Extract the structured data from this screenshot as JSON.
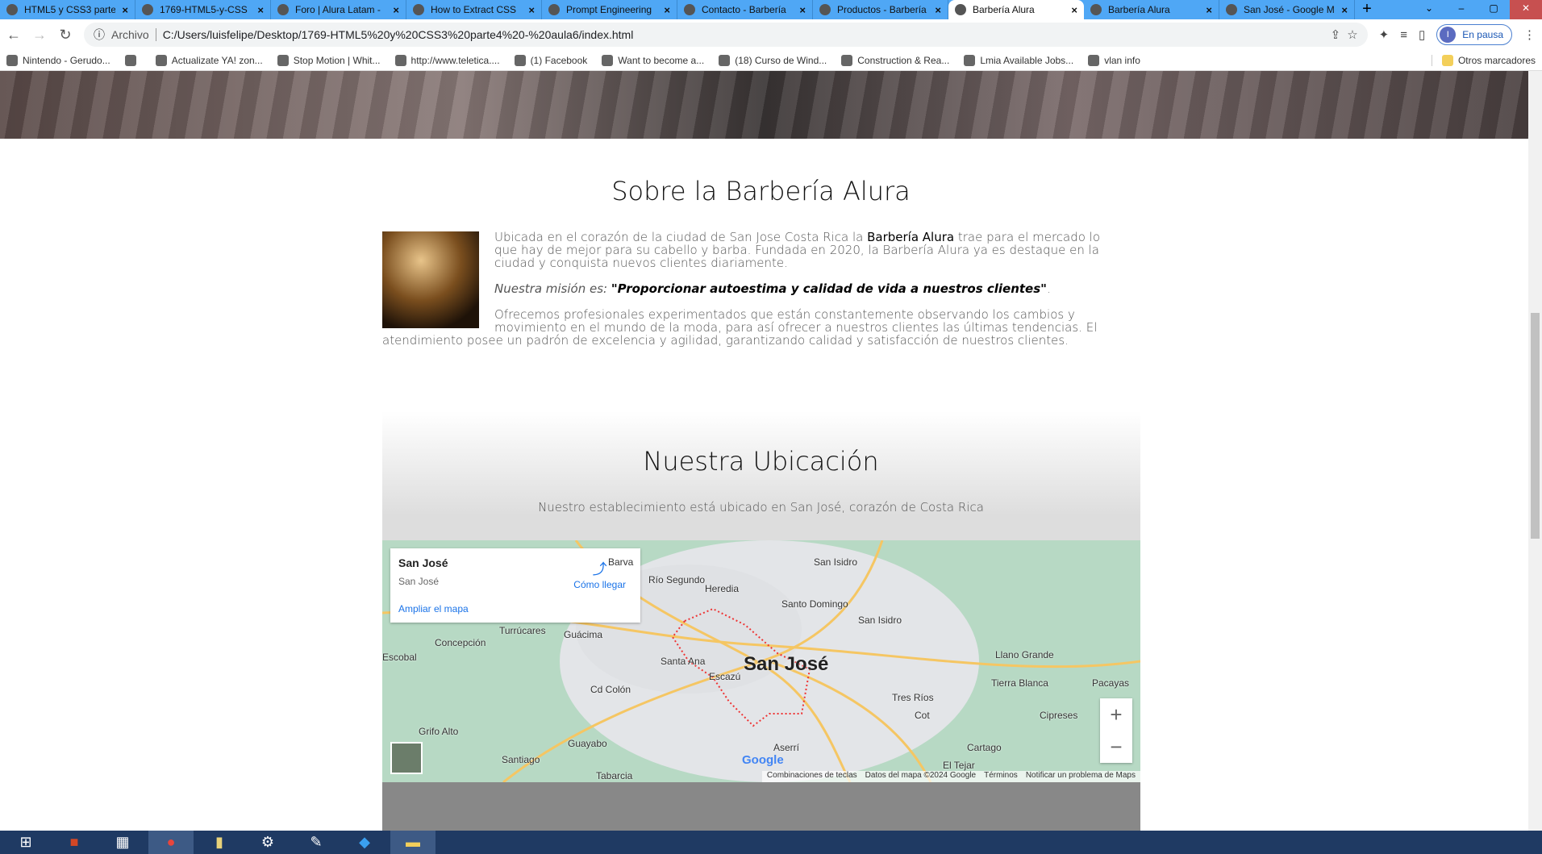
{
  "browser": {
    "tabs": [
      {
        "label": "HTML5 y CSS3 parte",
        "icon": "alura-icon"
      },
      {
        "label": "1769-HTML5-y-CSS",
        "icon": "github-icon"
      },
      {
        "label": "Foro | Alura Latam -",
        "icon": "alura-icon"
      },
      {
        "label": "How to Extract CSS",
        "icon": "youtube-icon"
      },
      {
        "label": "Prompt Engineering",
        "icon": "page-icon"
      },
      {
        "label": "Contacto - Barbería",
        "icon": "globe-icon"
      },
      {
        "label": "Productos - Barbería",
        "icon": "globe-icon"
      },
      {
        "label": "Barbería Alura",
        "icon": "globe-icon",
        "active": true
      },
      {
        "label": "Barbería Alura",
        "icon": "globe-icon"
      },
      {
        "label": "San José - Google M",
        "icon": "maps-icon"
      }
    ],
    "address": {
      "scheme_label": "Archivo",
      "url": "C:/Users/luisfelipe/Desktop/1769-HTML5%20y%20CSS3%20parte4%20-%20aula6/index.html"
    },
    "profile": {
      "initial": "I",
      "status": "En pausa"
    },
    "bookmarks": [
      "Nintendo - Gerudo...",
      "",
      "Actualizate YA! zon...",
      "Stop Motion | Whit...",
      "http://www.teletica....",
      "(1) Facebook",
      "Want to become a...",
      "(18) Curso de Wind...",
      "Construction & Rea...",
      "Lmia Available Jobs...",
      "vlan info"
    ],
    "other_bookmarks": "Otros marcadores"
  },
  "about": {
    "title": "Sobre la Barbería Alura",
    "p1_a": "Ubicada en el corazón de la ciudad de San Jose Costa Rica la ",
    "p1_b": "Barbería Alura",
    "p1_c": " trae para el mercado lo que hay de mejor para su cabello y barba. Fundada en 2020, la Barbería Alura ya es destaque en la ciudad y conquista nuevos clientes diariamente.",
    "mission_label": "Nuestra misión es: ",
    "mission": "\"Proporcionar autoestima y calidad de vida a nuestros clientes\"",
    "mission_end": ".",
    "p3": "Ofrecemos profesionales experimentados que están constantemente observando los cambios y movimiento en el mundo de la moda, para así ofrecer a nuestros clientes las últimas tendencias. El atendimiento posee un padrón de excelencia y agilidad, garantizando calidad y satisfacción de nuestros clientes."
  },
  "location": {
    "title": "Nuestra Ubicación",
    "subtitle": "Nuestro establecimiento está ubicado en San José, corazón de Costa Rica"
  },
  "map": {
    "place": "San José",
    "place_sub": "San José",
    "directions": "Cómo llegar",
    "enlarge": "Ampliar el mapa",
    "labels": [
      "Barva",
      "San Isidro",
      "Heredia",
      "Santo Domingo",
      "San Isidro",
      "Río Segundo",
      "Turrúcares",
      "Guácima",
      "Concepción",
      "Escobal",
      "Santa Ana",
      "Escazú",
      "Cd Colón",
      "Llano Grande",
      "Tierra Blanca",
      "Pacayas",
      "Tres Ríos",
      "Cot",
      "Cipreses",
      "Grifo Alto",
      "Guayabo",
      "Santiago",
      "Tabarcia",
      "Aserrí",
      "Cartago",
      "El Tejar"
    ],
    "city": "San José",
    "google": "Google",
    "attribution": [
      "Combinaciones de teclas",
      "Datos del mapa ©2024 Google",
      "Términos",
      "Notificar un problema de Maps"
    ],
    "zoom_in": "+",
    "zoom_out": "−"
  }
}
